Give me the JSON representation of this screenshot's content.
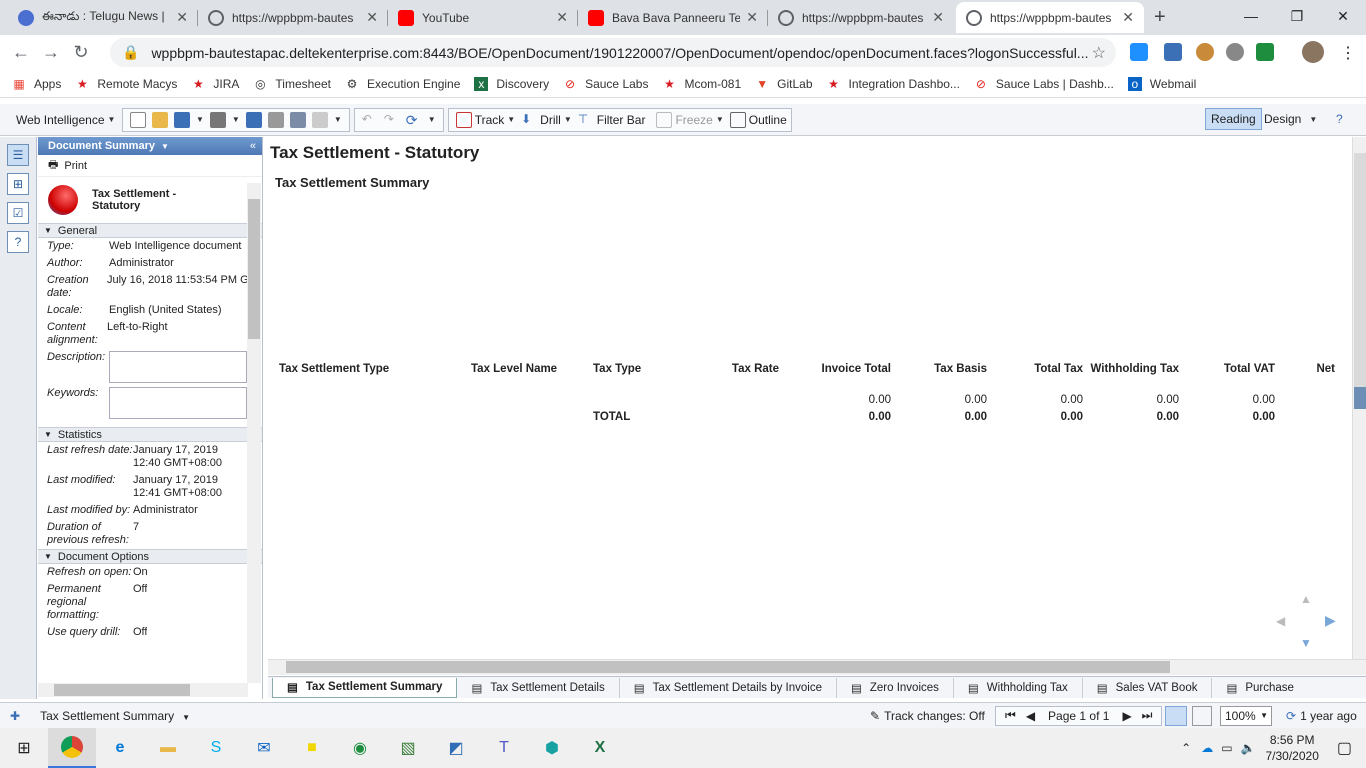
{
  "browser": {
    "tabs": [
      {
        "title": "ఈనాడు : Telugu News |",
        "favicon_color": "#4a6fd1"
      },
      {
        "title": "https://wppbpm-bautes",
        "favicon_color": "#5f6368"
      },
      {
        "title": "YouTube",
        "favicon_color": "#ff0000"
      },
      {
        "title": "Bava Bava Panneeru Tel",
        "favicon_color": "#ff0000"
      },
      {
        "title": "https://wppbpm-bautes",
        "favicon_color": "#5f6368"
      },
      {
        "title": "https://wppbpm-bautes",
        "favicon_color": "#5f6368"
      }
    ],
    "url": "wppbpm-bautestapac.deltekenterprise.com:8443/BOE/OpenDocument/1901220007/OpenDocument/opendoc/openDocument.faces?logonSuccessful...",
    "bookmarks": [
      "Apps",
      "Remote Macys",
      "JIRA",
      "Timesheet",
      "Execution Engine",
      "Discovery",
      "Sauce Labs",
      "Mcom-081",
      "GitLab",
      "Integration Dashbo...",
      "Sauce Labs | Dashb...",
      "Webmail"
    ]
  },
  "toolbar": {
    "app_menu": "Web Intelligence",
    "track": "Track",
    "drill": "Drill",
    "filter_bar": "Filter Bar",
    "freeze": "Freeze",
    "outline": "Outline",
    "reading": "Reading",
    "design": "Design"
  },
  "panel": {
    "header": "Document Summary",
    "print": "Print",
    "doc_title": "Tax Settlement - Statutory",
    "general": "General",
    "general_props": [
      {
        "k": "Type:",
        "v": "Web Intelligence document"
      },
      {
        "k": "Author:",
        "v": "Administrator"
      },
      {
        "k": "Creation date:",
        "v": "July 16, 2018 11:53:54 PM G"
      },
      {
        "k": "Locale:",
        "v": "English (United States)"
      },
      {
        "k": "Content alignment:",
        "v": "Left-to-Right"
      }
    ],
    "description_label": "Description:",
    "keywords_label": "Keywords:",
    "statistics": "Statistics",
    "stats_props": [
      {
        "k": "Last refresh date:",
        "v": "January 17, 2019 12:40 GMT+08:00"
      },
      {
        "k": "Last modified:",
        "v": "January 17, 2019 12:41 GMT+08:00"
      },
      {
        "k": "Last modified by:",
        "v": "Administrator"
      },
      {
        "k": "Duration of previous refresh:",
        "v": "7"
      }
    ],
    "document_options": "Document Options",
    "options_props": [
      {
        "k": "Refresh on open:",
        "v": "On"
      },
      {
        "k": "Permanent regional formatting:",
        "v": "Off"
      },
      {
        "k": "Use query drill:",
        "v": "Off"
      }
    ]
  },
  "report": {
    "title": "Tax Settlement - Statutory",
    "subtitle": "Tax Settlement Summary",
    "columns": [
      "Tax Settlement Type",
      "Tax Level Name",
      "Tax Type",
      "Tax Rate",
      "Invoice Total",
      "Tax Basis",
      "Total Tax",
      "Withholding Tax",
      "Total VAT",
      "Net"
    ],
    "row1": [
      "",
      "",
      "",
      "",
      "0.00",
      "0.00",
      "0.00",
      "0.00",
      "0.00",
      ""
    ],
    "total_label": "TOTAL",
    "total_row": [
      "0.00",
      "0.00",
      "0.00",
      "0.00",
      "0.00"
    ]
  },
  "report_tabs": [
    "Tax Settlement Summary",
    "Tax Settlement Details",
    "Tax Settlement Details by Invoice",
    "Zero Invoices",
    "Withholding Tax",
    "Sales VAT Book",
    "Purchase"
  ],
  "status": {
    "report_name": "Tax Settlement Summary",
    "track_changes": "Track changes: Off",
    "page": "Page 1 of 1",
    "zoom": "100%",
    "refreshed": "1 year ago"
  },
  "taskbar": {
    "time": "8:56 PM",
    "date": "7/30/2020"
  }
}
